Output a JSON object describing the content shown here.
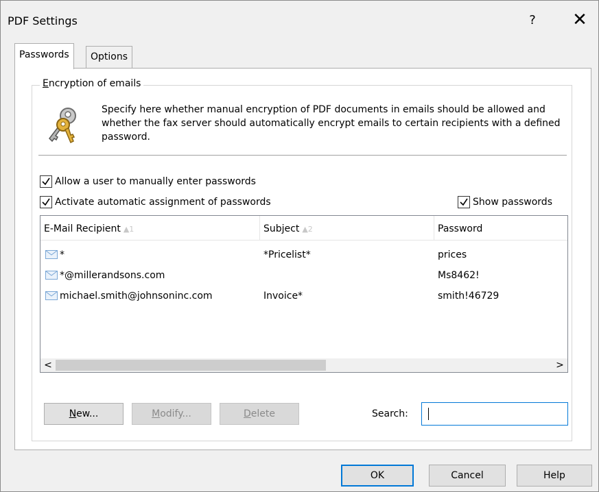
{
  "window": {
    "title": "PDF Settings",
    "help_glyph": "?",
    "close_glyph": "✕"
  },
  "tabs": [
    {
      "label": "Passwords",
      "active": true
    },
    {
      "label": "Options",
      "active": false
    }
  ],
  "group": {
    "title_accel": "E",
    "title_rest": "ncryption of emails",
    "description": "Specify here whether manual encryption of PDF documents in emails should be allowed and whether the fax server should automatically encrypt emails to certain recipients with a defined password.",
    "icon": "keys-icon"
  },
  "checkboxes": {
    "allow_manual": {
      "label": "Allow a user to manually enter passwords",
      "checked": true
    },
    "auto_assign": {
      "label": "Activate automatic assignment of passwords",
      "checked": true
    },
    "show_passwords": {
      "label": "Show passwords",
      "checked": true
    }
  },
  "table": {
    "columns": [
      {
        "label": "E-Mail Recipient",
        "sort": "▲1"
      },
      {
        "label": "Subject",
        "sort": "▲2"
      },
      {
        "label": "Password",
        "sort": ""
      }
    ],
    "rows": [
      {
        "recipient": "*",
        "subject": "*Pricelist*",
        "password": "prices",
        "icon": "mail-icon"
      },
      {
        "recipient": "*@millerandsons.com",
        "subject": "",
        "password": "Ms8462!",
        "icon": "mail-icon"
      },
      {
        "recipient": "michael.smith@johnsoninc.com",
        "subject": "Invoice*",
        "password": "smith!46729",
        "icon": "mail-icon"
      }
    ],
    "scroll_left": "<",
    "scroll_right": ">"
  },
  "actions": {
    "new": {
      "accel": "N",
      "rest": "ew..."
    },
    "modify": {
      "accel": "M",
      "rest": "odify..."
    },
    "delete": {
      "accel": "D",
      "rest": "elete"
    },
    "search_label": "Search:",
    "search_value": ""
  },
  "dialog_buttons": {
    "ok": "OK",
    "cancel": "Cancel",
    "help": "Help"
  },
  "colors": {
    "accent": "#0078d7",
    "mail_icon": "#7aa7d6"
  }
}
